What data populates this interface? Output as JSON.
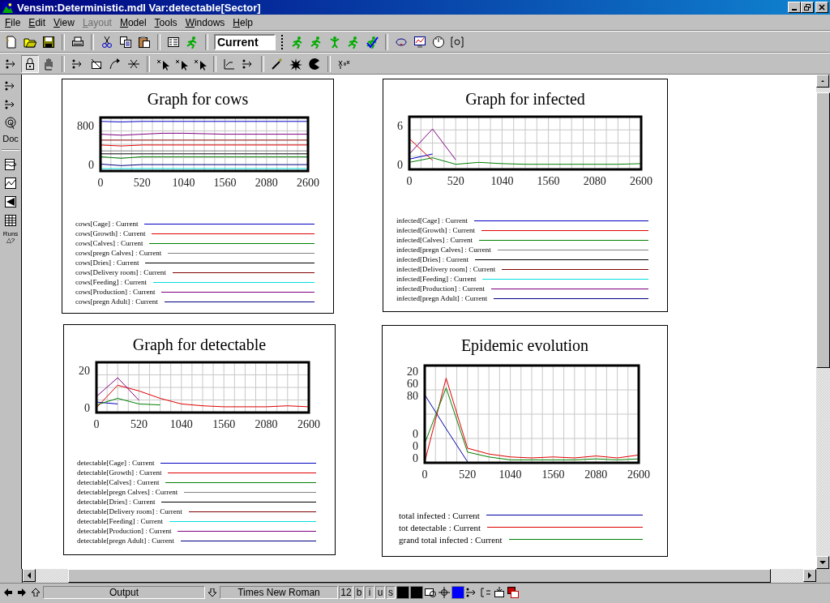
{
  "window": {
    "title": "Vensim:Deterministic.mdl Var:detectable[Sector]"
  },
  "menu": [
    {
      "label": "File",
      "disabled": false
    },
    {
      "label": "Edit",
      "disabled": false
    },
    {
      "label": "View",
      "disabled": false
    },
    {
      "label": "Layout",
      "disabled": true
    },
    {
      "label": "Model",
      "disabled": false
    },
    {
      "label": "Tools",
      "disabled": false
    },
    {
      "label": "Windows",
      "disabled": false
    },
    {
      "label": "Help",
      "disabled": false
    }
  ],
  "toolbar": {
    "groups": [
      [
        {
          "kind": "new"
        },
        {
          "kind": "open"
        },
        {
          "kind": "save"
        }
      ],
      [
        {
          "kind": "print"
        }
      ],
      [
        {
          "kind": "cut"
        },
        {
          "kind": "copy"
        },
        {
          "kind": "paste"
        }
      ],
      [
        {
          "kind": "panel"
        },
        {
          "kind": "runner"
        }
      ]
    ],
    "run_name": "Current",
    "run_tools": [
      {
        "kind": "runner"
      },
      {
        "kind": "runner"
      },
      {
        "kind": "figure"
      },
      {
        "kind": "runner"
      },
      {
        "kind": "check"
      }
    ],
    "analysis": [
      {
        "kind": "loop"
      },
      {
        "kind": "screen"
      },
      {
        "kind": "gauge"
      },
      {
        "kind": "bracket"
      }
    ]
  },
  "sketch_tools": {
    "groups": [
      [
        {
          "kind": "arrow",
          "selected": false
        },
        {
          "kind": "lock",
          "selected": true
        },
        {
          "kind": "hand",
          "selected": false
        }
      ],
      [
        {
          "kind": "arrow",
          "selected": false
        },
        {
          "kind": "box",
          "selected": false
        },
        {
          "kind": "curve",
          "selected": false
        },
        {
          "kind": "valve",
          "selected": false
        }
      ],
      [
        {
          "kind": "cursor",
          "selected": false
        },
        {
          "kind": "cursor",
          "selected": false
        },
        {
          "kind": "cursor",
          "selected": false
        }
      ],
      [
        {
          "kind": "rate",
          "selected": false
        },
        {
          "kind": "arrow",
          "selected": false
        }
      ],
      [
        {
          "kind": "wand",
          "selected": false
        },
        {
          "kind": "burst",
          "selected": false
        },
        {
          "kind": "pac",
          "selected": false
        }
      ],
      [
        {
          "kind": "equation",
          "selected": false
        }
      ]
    ]
  },
  "side_tools": [
    {
      "kind": "arrow"
    },
    {
      "kind": "arrow"
    },
    {
      "kind": "radar"
    },
    {
      "kind": "text",
      "label": "Doc"
    },
    {
      "kind": "separator"
    },
    {
      "kind": "strip"
    },
    {
      "kind": "graph"
    },
    {
      "kind": "tree"
    },
    {
      "kind": "table"
    },
    {
      "kind": "runs",
      "label": "Runs",
      "sub": "△?"
    }
  ],
  "graphs": [
    {
      "chart_data": {
        "type": "line",
        "title": "Graph for cows",
        "grid": true,
        "x": [
          0,
          260,
          520,
          780,
          1040,
          1300,
          1560,
          1820,
          2080,
          2340,
          2600
        ],
        "xlim": [
          0,
          2600
        ],
        "ylim": [
          -130,
          960
        ],
        "xticks": [
          0,
          520,
          1040,
          1560,
          2080,
          2600
        ],
        "yticks": [
          0,
          800
        ],
        "series": [
          {
            "name": "cows[Cage] : Current",
            "color": "#0000c0",
            "values": [
              880,
              870,
              880,
              880,
              880,
              880,
              880,
              880,
              880,
              880,
              880
            ]
          },
          {
            "name": "cows[Growth] : Current",
            "color": "#e00000",
            "values": [
              400,
              380,
              400,
              400,
              400,
              400,
              400,
              400,
              400,
              400,
              400
            ]
          },
          {
            "name": "cows[Calves] : Current",
            "color": "#008000",
            "values": [
              160,
              130,
              160,
              160,
              160,
              160,
              160,
              160,
              160,
              160,
              160
            ]
          },
          {
            "name": "cows[pregn Calves] : Current",
            "color": "#808080",
            "values": [
              280,
              280,
              280,
              280,
              280,
              280,
              280,
              280,
              280,
              280,
              280
            ]
          },
          {
            "name": "cows[Dries] : Current",
            "color": "#000000",
            "values": [
              220,
              220,
              220,
              220,
              220,
              220,
              220,
              220,
              220,
              220,
              220
            ]
          },
          {
            "name": "cows[Delivery room] : Current",
            "color": "#800000",
            "values": [
              500,
              500,
              500,
              500,
              500,
              500,
              500,
              500,
              500,
              500,
              500
            ]
          },
          {
            "name": "cows[Feeding] : Current",
            "color": "#00e0e0",
            "values": [
              -80,
              -80,
              -80,
              -80,
              -80,
              -80,
              -80,
              -80,
              -80,
              -80,
              -80
            ]
          },
          {
            "name": "cows[Production] : Current",
            "color": "#800080",
            "values": [
              620,
              600,
              620,
              640,
              640,
              630,
              620,
              620,
              620,
              620,
              620
            ]
          },
          {
            "name": "cows[pregn Adult] : Current",
            "color": "#000080",
            "values": [
              10,
              -20,
              0,
              0,
              0,
              0,
              0,
              0,
              0,
              0,
              0
            ]
          }
        ]
      }
    },
    {
      "chart_data": {
        "type": "line",
        "title": "Graph for infected",
        "grid": true,
        "x": [
          0,
          260,
          520,
          780,
          1040,
          1300,
          1560,
          1820,
          2080,
          2340,
          2600
        ],
        "xlim": [
          0,
          2600
        ],
        "ylim": [
          -0.8,
          7.4
        ],
        "xticks": [
          0,
          520,
          1040,
          1560,
          2080,
          2600
        ],
        "yticks": [
          0,
          6
        ],
        "series": [
          {
            "name": "infected[Cage] : Current",
            "color": "#0000c0",
            "values": [
              0.8,
              1.6,
              null,
              null,
              null,
              null,
              null,
              null,
              null,
              null,
              null
            ]
          },
          {
            "name": "infected[Growth] : Current",
            "color": "#e00000",
            "values": [
              4,
              0.6,
              null,
              null,
              null,
              null,
              null,
              null,
              null,
              null,
              null
            ]
          },
          {
            "name": "infected[Calves] : Current",
            "color": "#008000",
            "values": [
              0.3,
              1,
              0,
              0.3,
              0.1,
              0,
              0,
              0,
              0,
              0,
              0.1
            ]
          },
          {
            "name": "infected[pregn Calves] : Current",
            "color": "#808080",
            "values": [
              null,
              null,
              null,
              null,
              null,
              null,
              null,
              null,
              null,
              null,
              null
            ]
          },
          {
            "name": "infected[Dries] : Current",
            "color": "#000000",
            "values": [
              null,
              null,
              null,
              null,
              null,
              null,
              null,
              null,
              null,
              null,
              null
            ]
          },
          {
            "name": "infected[Delivery room] : Current",
            "color": "#800000",
            "values": [
              null,
              null,
              null,
              null,
              null,
              null,
              null,
              null,
              null,
              null,
              null
            ]
          },
          {
            "name": "infected[Feeding] : Current",
            "color": "#00e0e0",
            "values": [
              null,
              null,
              null,
              null,
              null,
              null,
              null,
              null,
              null,
              null,
              null
            ]
          },
          {
            "name": "infected[Production] : Current",
            "color": "#800080",
            "values": [
              1.6,
              5.5,
              0.7,
              null,
              null,
              null,
              null,
              null,
              null,
              null,
              null
            ]
          },
          {
            "name": "infected[pregn Adult] : Current",
            "color": "#000080",
            "values": [
              null,
              null,
              null,
              null,
              null,
              null,
              null,
              null,
              null,
              null,
              null
            ]
          }
        ]
      }
    },
    {
      "chart_data": {
        "type": "line",
        "title": "Graph for detectable",
        "grid": true,
        "x": [
          0,
          260,
          520,
          780,
          1040,
          1300,
          1560,
          1820,
          2080,
          2340,
          2600
        ],
        "xlim": [
          0,
          2600
        ],
        "ylim": [
          -2.6,
          24.3
        ],
        "xticks": [
          0,
          520,
          1040,
          1560,
          2080,
          2600
        ],
        "yticks": [
          0,
          20
        ],
        "series": [
          {
            "name": "detectable[Cage] : Current",
            "color": "#0000c0",
            "values": [
              3,
              2,
              null,
              null,
              null,
              null,
              null,
              null,
              null,
              null,
              null
            ]
          },
          {
            "name": "detectable[Growth] : Current",
            "color": "#e00000",
            "values": [
              0,
              12,
              9,
              5,
              2,
              1,
              0.5,
              0.5,
              0.5,
              1,
              0.5
            ]
          },
          {
            "name": "detectable[Calves] : Current",
            "color": "#008000",
            "values": [
              1.5,
              5,
              2,
              1.5,
              null,
              null,
              null,
              null,
              null,
              null,
              null
            ]
          },
          {
            "name": "detectable[pregn Calves] : Current",
            "color": "#808080",
            "values": [
              null,
              null,
              null,
              null,
              null,
              null,
              null,
              null,
              null,
              null,
              null
            ]
          },
          {
            "name": "detectable[Dries] : Current",
            "color": "#000000",
            "values": [
              null,
              null,
              null,
              null,
              null,
              null,
              null,
              null,
              null,
              null,
              null
            ]
          },
          {
            "name": "detectable[Delivery room] : Current",
            "color": "#800000",
            "values": [
              null,
              null,
              null,
              null,
              null,
              null,
              null,
              null,
              null,
              null,
              null
            ]
          },
          {
            "name": "detectable[Feeding] : Current",
            "color": "#00e0e0",
            "values": [
              null,
              null,
              null,
              null,
              null,
              null,
              null,
              null,
              null,
              null,
              null
            ]
          },
          {
            "name": "detectable[Production] : Current",
            "color": "#800080",
            "values": [
              6,
              16,
              4,
              null,
              null,
              null,
              null,
              null,
              null,
              null,
              null
            ]
          },
          {
            "name": "detectable[pregn Adult] : Current",
            "color": "#000080",
            "values": [
              null,
              null,
              null,
              null,
              null,
              null,
              null,
              null,
              null,
              null,
              null
            ]
          }
        ]
      }
    },
    {
      "title": "Epidemic evolution",
      "axis_labels": [
        "20",
        "60",
        "80",
        "0",
        "0",
        "0"
      ],
      "x_labels": [
        "0",
        "520",
        "1040",
        "1560",
        "2080",
        "2600"
      ],
      "legend": [
        {
          "name": "total infected : Current",
          "color": "#0000a0"
        },
        {
          "name": "tot detectable : Current",
          "color": "#e00000"
        },
        {
          "name": "grand total infected : Current",
          "color": "#008000"
        }
      ]
    }
  ],
  "status_bar": {
    "output": "Output",
    "font": "Times New Roman",
    "size": "12",
    "styles": [
      "b",
      "i",
      "u",
      "s"
    ],
    "tools": [
      {
        "kind": "swatch",
        "color": "#000000"
      },
      {
        "kind": "swatch",
        "color": "#000000"
      },
      {
        "kind": "shape"
      },
      {
        "kind": "crosshair"
      },
      {
        "kind": "swatch",
        "color": "#0000ff"
      },
      {
        "kind": "arrow"
      },
      {
        "kind": "position"
      },
      {
        "kind": "variable"
      },
      {
        "kind": "layers"
      }
    ]
  }
}
